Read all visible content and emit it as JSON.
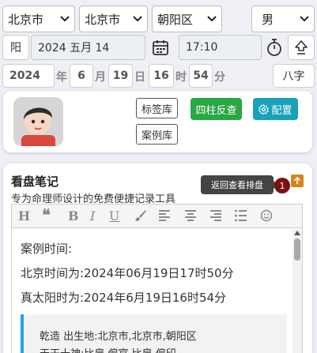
{
  "location": {
    "province": "北京市",
    "city": "北京市",
    "district": "朝阳区",
    "gender": "男"
  },
  "date_row": {
    "calendar_toggle": "阳",
    "date_value": "2024 五月 14",
    "time_value": "17:10"
  },
  "detail_row": {
    "year_value": "2024",
    "year_unit": "年",
    "month_value": "6",
    "month_unit": "月",
    "day_value": "19",
    "day_unit": "日",
    "hour_value": "16",
    "hour_unit": "时",
    "minute_value": "54",
    "minute_unit": "分",
    "bazi_button": "八字"
  },
  "profile_card": {
    "tag_library": "标签库",
    "case_library": "案例库",
    "four_pillars_button": "四柱反查",
    "config_button": "配置"
  },
  "notes": {
    "title": "看盘笔记",
    "subtitle": "专为命理师设计的免费便捷记录工具",
    "tooltip": "返回查看排盘",
    "badge_count": "1",
    "lines": [
      "案例时间:",
      "北京时间为:2024年06月19日17时50分",
      "真太阳时为:2024年6月19日16时54分"
    ],
    "quote_line1": "乾造 出生地:北京市,北京市,朝阳区",
    "quote_line2": "天干十神:比肩 偏官 比肩 偏印"
  },
  "colors": {
    "green": "#28a745",
    "teal": "#17a2b8",
    "orange": "#d4861a",
    "badge": "#7b1113",
    "tooltip_bg": "#444444",
    "quote_border": "#1fa3e8"
  }
}
